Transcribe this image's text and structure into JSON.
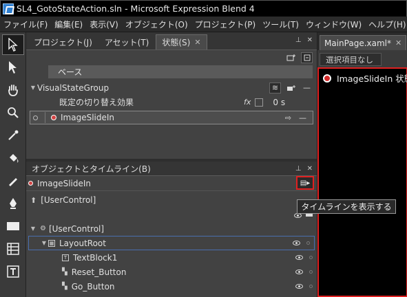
{
  "window": {
    "title": "SL4_GotoStateAction.sln - Microsoft Expression Blend 4"
  },
  "menu": [
    "ファイル(F)",
    "編集(E)",
    "表示(V)",
    "オブジェクト(O)",
    "プロジェクト(P)",
    "ツール(T)",
    "ウィンドウ(W)",
    "ヘルプ(H)"
  ],
  "tabs": [
    "プロジェクト(J)",
    "アセット(T)",
    "状態(S)"
  ],
  "states": {
    "base": "ベース",
    "group": "VisualStateGroup",
    "transition": "既定の切り替え効果",
    "transition_time": "0 s",
    "state_name": "ImageSlideIn"
  },
  "objects": {
    "header": "オブジェクトとタイムライン(B)",
    "current_state": "ImageSlideIn",
    "tooltip": "タイムラインを表示する",
    "scope": "[UserControl]",
    "tree": [
      {
        "label": "[UserControl]"
      },
      {
        "label": "LayoutRoot"
      },
      {
        "label": "TextBlock1"
      },
      {
        "label": "Reset_Button"
      },
      {
        "label": "Go_Button"
      }
    ]
  },
  "document": {
    "tab": "MainPage.xaml*",
    "selection": "選択項目なし",
    "recording_label": "ImageSlideIn 状態"
  },
  "colors": {
    "record_red": "#e02020",
    "selection_blue": "#4a6fb0"
  }
}
